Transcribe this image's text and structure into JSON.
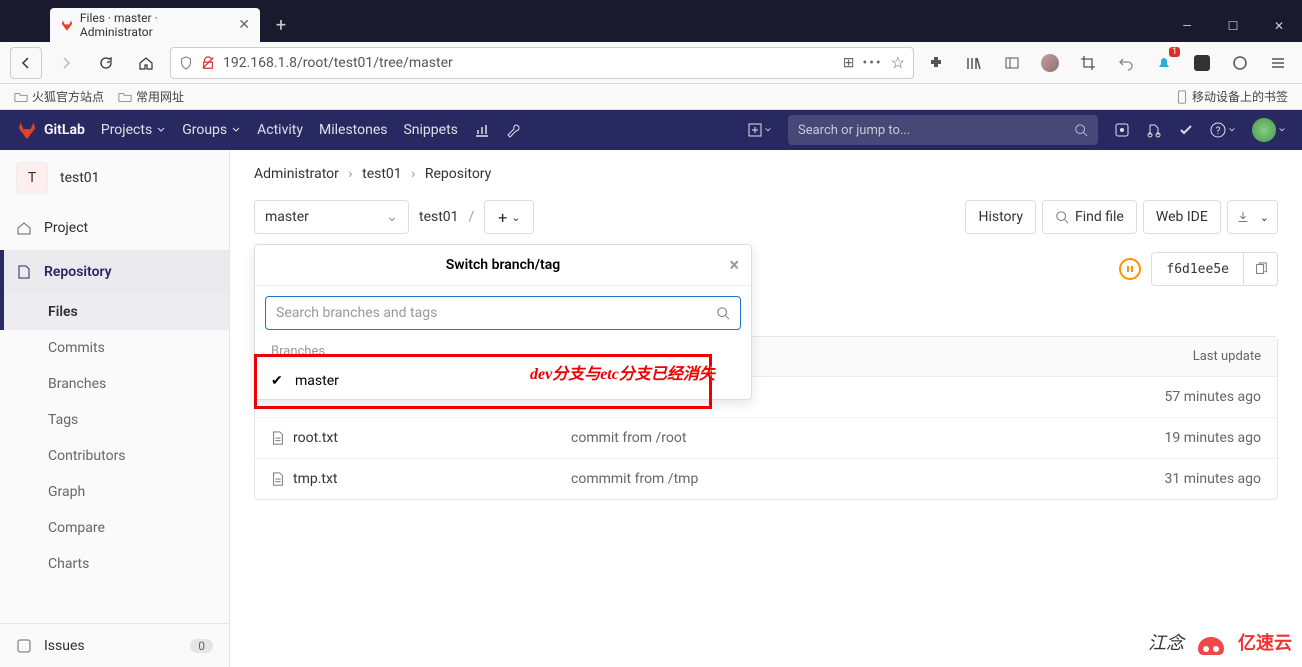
{
  "browser": {
    "tab_title": "Files · master · Administrator",
    "window_controls": {
      "min": "—",
      "max": "☐",
      "close": "✕"
    },
    "address": "192.168.1.8/root/test01/tree/master",
    "bookmarks": {
      "b1": "火狐官方站点",
      "b2": "常用网址",
      "mobile": "移动设备上的书签"
    },
    "notification_badge": "1"
  },
  "gitlab": {
    "brand": "GitLab",
    "nav": {
      "projects": "Projects",
      "groups": "Groups",
      "activity": "Activity",
      "milestones": "Milestones",
      "snippets": "Snippets"
    },
    "search_placeholder": "Search or jump to..."
  },
  "sidebar": {
    "project_letter": "T",
    "project_name": "test01",
    "items": {
      "project": "Project",
      "repository": "Repository",
      "issues": "Issues",
      "issues_count": "0"
    },
    "repo_sub": {
      "files": "Files",
      "commits": "Commits",
      "branches": "Branches",
      "tags": "Tags",
      "contributors": "Contributors",
      "graph": "Graph",
      "compare": "Compare",
      "charts": "Charts"
    }
  },
  "breadcrumb": {
    "a": "Administrator",
    "b": "test01",
    "c": "Repository"
  },
  "repo": {
    "branch": "master",
    "path_root": "test01",
    "path_sep": "/",
    "history": "History",
    "find_file": "Find file",
    "web_ide": "Web IDE",
    "commit_sha": "f6d1ee5e"
  },
  "branch_panel": {
    "title": "Switch branch/tag",
    "search_placeholder": "Search branches and tags",
    "section": "Branches",
    "items": [
      {
        "name": "master",
        "checked": true
      }
    ]
  },
  "annotation": "dev分支与etc分支已经消失",
  "table": {
    "head_update": "Last update",
    "rows": [
      {
        "name": "",
        "commit": "",
        "update": "57 minutes ago"
      },
      {
        "name": "root.txt",
        "commit": "commit from /root",
        "update": "19 minutes ago"
      },
      {
        "name": "tmp.txt",
        "commit": "commmit from /tmp",
        "update": "31 minutes ago"
      }
    ]
  },
  "watermark": {
    "text": "江念",
    "brand": "亿速云"
  }
}
